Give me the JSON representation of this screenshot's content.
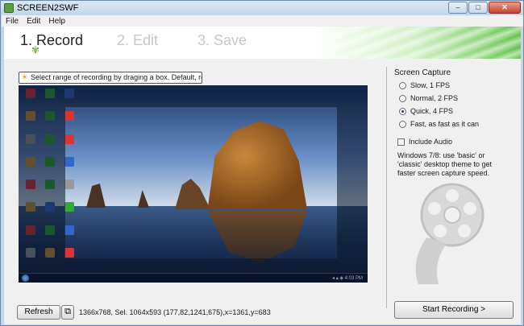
{
  "window": {
    "title": "SCREEN2SWF",
    "controls": {
      "minimize": "–",
      "maximize": "□",
      "close": "✕"
    }
  },
  "menu": [
    "File",
    "Edit",
    "Help"
  ],
  "steps": [
    {
      "label": "1. Record",
      "active": true
    },
    {
      "label": "2. Edit",
      "active": false
    },
    {
      "label": "3. Save",
      "active": false
    }
  ],
  "tip": {
    "icon": "lightbulb-icon",
    "text": "Select range of recording by draging a box. Default, record all."
  },
  "preview": {
    "tray_text": "◂ ▴ ◈ 4:03 PM",
    "desk_icon_colors": [
      "#d33",
      "#3a3",
      "#36c",
      "#c93",
      "#3a3",
      "#d33",
      "#999",
      "#3a3",
      "#d33",
      "#c93",
      "#3a3",
      "#36c",
      "#d33",
      "#3a3",
      "#999",
      "#c93",
      "#36c",
      "#3a3",
      "#d33",
      "#3a3",
      "#36c",
      "#999",
      "#c93",
      "#d33"
    ]
  },
  "buttons": {
    "refresh": "Refresh",
    "region_icon": "⧉",
    "start_recording": "Start Recording >"
  },
  "status": "1366x768, Sel. 1064x593 (177,82,1241,675),x=1361,y=683",
  "capture": {
    "title": "Screen Capture",
    "options": [
      "Slow, 1 FPS",
      "Normal, 2 FPS",
      "Quick, 4 FPS",
      "Fast, as fast as it can"
    ],
    "selected_index": 2,
    "include_audio_label": "Include Audio",
    "include_audio_checked": false,
    "note": "Windows 7/8: use 'basic' or 'classic' desktop theme to get faster screen capture speed."
  },
  "colors": {
    "accent_green": "#62c24a",
    "window_frame": "#c5d5e8"
  }
}
